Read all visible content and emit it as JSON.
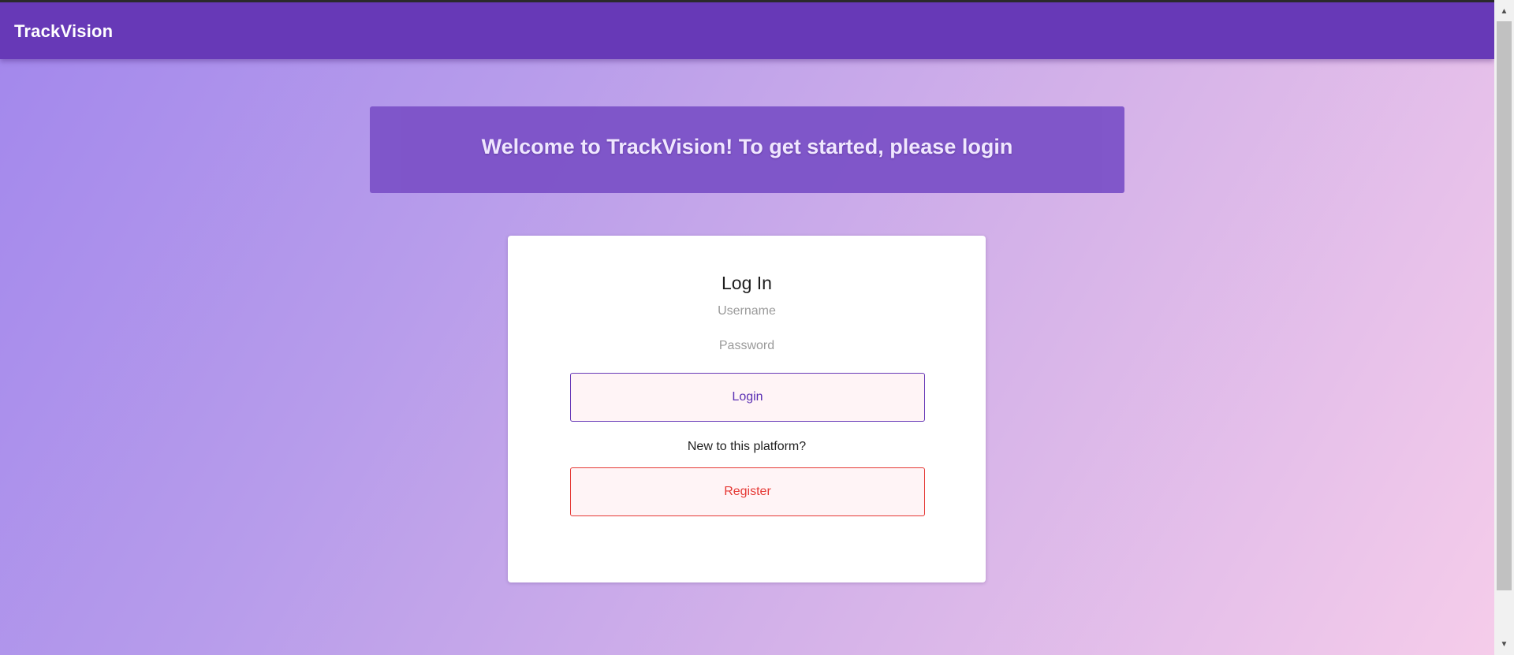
{
  "app": {
    "title": "TrackVision"
  },
  "banner": {
    "text": "Welcome to TrackVision! To get started, please login"
  },
  "login_card": {
    "title": "Log In",
    "username_placeholder": "Username",
    "password_placeholder": "Password",
    "login_label": "Login",
    "new_user_text": "New to this platform?",
    "register_label": "Register"
  },
  "scrollbar": {
    "up_icon": "arrow-up-icon",
    "down_icon": "arrow-down-icon"
  },
  "colors": {
    "appbar": "#6739b7",
    "banner": "#7d53c8",
    "login_accent": "#6739b7",
    "register_accent": "#e53935",
    "button_bg": "#fff4f6"
  }
}
